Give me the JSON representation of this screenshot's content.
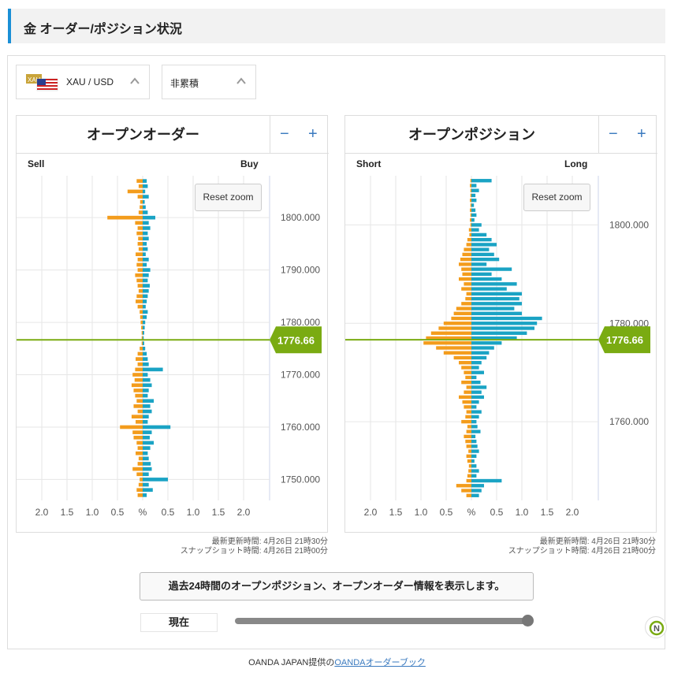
{
  "header": {
    "title": "金 オーダー/ポジション状況"
  },
  "selectors": {
    "pair_label": "XAU / USD",
    "flag_text": "XAU",
    "mode_label": "非累積"
  },
  "order_book": {
    "title": "オープンオーダー",
    "left_label": "Sell",
    "right_label": "Buy",
    "reset_label": "Reset zoom",
    "zoom_out": "−",
    "zoom_in": "+",
    "price_ticks": [
      "1800.000",
      "1790.000",
      "1780.000",
      "1770.000",
      "1760.000",
      "1750.000"
    ],
    "x_ticks": [
      "2.0",
      "1.5",
      "1.0",
      "0.5",
      "%",
      "0.5",
      "1.0",
      "1.5",
      "2.0"
    ],
    "current_price": "1776.66",
    "updated": "最新更新時間: 4月26日 21時30分",
    "snapshot": "スナップショット時間: 4月26日 21時00分"
  },
  "position_book": {
    "title": "オープンポジション",
    "left_label": "Short",
    "right_label": "Long",
    "reset_label": "Reset zoom",
    "zoom_out": "−",
    "zoom_in": "+",
    "price_ticks": [
      "1800.000",
      "1780.000",
      "1760.000"
    ],
    "x_ticks": [
      "2.0",
      "1.5",
      "1.0",
      "0.5",
      "%",
      "0.5",
      "1.0",
      "1.5",
      "2.0"
    ],
    "current_price": "1776.66",
    "updated": "最新更新時間: 4月26日 21時30分",
    "snapshot": "スナップショット時間: 4月26日 21時00分"
  },
  "history": {
    "button_label": "過去24時間のオープンポジション、オープンオーダー情報を表示します。",
    "now_label": "現在",
    "slider_value": 1.0
  },
  "footer": {
    "prefix": "OANDA JAPAN提供の",
    "link": "OANDAオーダーブック"
  },
  "colors": {
    "accent": "#1a8fd6",
    "orange": "#f39c1c",
    "teal": "#1aa3c4",
    "price_line": "#7aab12"
  },
  "chart_data": [
    {
      "type": "bar",
      "title": "オープンオーダー",
      "xlabel": "%",
      "ylim": [
        1746,
        1808
      ],
      "note_side": [
        "Sell",
        "Buy"
      ],
      "y": [
        1807,
        1806,
        1805,
        1804,
        1803,
        1802,
        1801,
        1800,
        1799,
        1798,
        1797,
        1796,
        1795,
        1794,
        1793,
        1792,
        1791,
        1790,
        1789,
        1788,
        1787,
        1786,
        1785,
        1784,
        1783,
        1782,
        1781,
        1780,
        1779,
        1778,
        1777,
        1776,
        1775,
        1774,
        1773,
        1772,
        1771,
        1770,
        1769,
        1768,
        1767,
        1766,
        1765,
        1764,
        1763,
        1762,
        1761,
        1760,
        1759,
        1758,
        1757,
        1756,
        1755,
        1754,
        1753,
        1752,
        1751,
        1750,
        1749,
        1748,
        1747
      ],
      "series": [
        {
          "name": "Sell",
          "values": [
            0.12,
            0.08,
            0.3,
            0.1,
            0.05,
            0.06,
            0.08,
            0.7,
            0.15,
            0.1,
            0.12,
            0.09,
            0.1,
            0.08,
            0.14,
            0.1,
            0.12,
            0.1,
            0.15,
            0.12,
            0.1,
            0.08,
            0.12,
            0.14,
            0.1,
            0.06,
            0.05,
            0.04,
            0.03,
            0.02,
            0.02,
            0.02,
            0.06,
            0.1,
            0.14,
            0.1,
            0.15,
            0.2,
            0.16,
            0.22,
            0.18,
            0.15,
            0.12,
            0.18,
            0.1,
            0.22,
            0.14,
            0.45,
            0.2,
            0.18,
            0.12,
            0.1,
            0.14,
            0.08,
            0.1,
            0.2,
            0.12,
            0.06,
            0.08,
            0.12,
            0.1
          ]
        },
        {
          "name": "Buy",
          "values": [
            0.08,
            0.1,
            0.05,
            0.12,
            0.04,
            0.06,
            0.1,
            0.25,
            0.12,
            0.15,
            0.1,
            0.12,
            0.08,
            0.1,
            0.06,
            0.12,
            0.08,
            0.15,
            0.12,
            0.1,
            0.14,
            0.12,
            0.1,
            0.08,
            0.06,
            0.1,
            0.08,
            0.05,
            0.04,
            0.03,
            0.02,
            0.03,
            0.05,
            0.08,
            0.1,
            0.12,
            0.4,
            0.1,
            0.15,
            0.18,
            0.12,
            0.1,
            0.22,
            0.15,
            0.18,
            0.12,
            0.1,
            0.55,
            0.18,
            0.14,
            0.22,
            0.15,
            0.1,
            0.12,
            0.16,
            0.18,
            0.12,
            0.5,
            0.12,
            0.2,
            0.08
          ]
        }
      ]
    },
    {
      "type": "bar",
      "title": "オープンポジション",
      "xlabel": "%",
      "ylim": [
        1744,
        1810
      ],
      "y": [
        1809,
        1808,
        1807,
        1806,
        1805,
        1804,
        1803,
        1802,
        1801,
        1800,
        1799,
        1798,
        1797,
        1796,
        1795,
        1794,
        1793,
        1792,
        1791,
        1790,
        1789,
        1788,
        1787,
        1786,
        1785,
        1784,
        1783,
        1782,
        1781,
        1780,
        1779,
        1778,
        1777,
        1776,
        1775,
        1774,
        1773,
        1772,
        1771,
        1770,
        1769,
        1768,
        1767,
        1766,
        1765,
        1764,
        1763,
        1762,
        1761,
        1760,
        1759,
        1758,
        1757,
        1756,
        1755,
        1754,
        1753,
        1752,
        1751,
        1750,
        1749,
        1748,
        1747,
        1746,
        1745
      ],
      "series": [
        {
          "name": "Short",
          "values": [
            0.02,
            0.03,
            0.02,
            0.02,
            0.03,
            0.02,
            0.03,
            0.02,
            0.03,
            0.02,
            0.05,
            0.04,
            0.08,
            0.1,
            0.15,
            0.18,
            0.22,
            0.25,
            0.2,
            0.18,
            0.25,
            0.15,
            0.2,
            0.1,
            0.12,
            0.2,
            0.3,
            0.35,
            0.4,
            0.55,
            0.65,
            0.8,
            0.9,
            0.95,
            0.7,
            0.55,
            0.35,
            0.25,
            0.2,
            0.15,
            0.12,
            0.2,
            0.1,
            0.15,
            0.25,
            0.18,
            0.15,
            0.1,
            0.12,
            0.2,
            0.08,
            0.1,
            0.15,
            0.12,
            0.1,
            0.06,
            0.1,
            0.08,
            0.05,
            0.06,
            0.08,
            0.1,
            0.3,
            0.2,
            0.1
          ]
        },
        {
          "name": "Long",
          "values": [
            0.4,
            0.1,
            0.15,
            0.08,
            0.1,
            0.05,
            0.08,
            0.1,
            0.06,
            0.2,
            0.15,
            0.3,
            0.4,
            0.5,
            0.35,
            0.45,
            0.55,
            0.3,
            0.8,
            0.4,
            0.6,
            0.9,
            0.7,
            1.0,
            0.95,
            1.0,
            0.85,
            1.0,
            1.4,
            1.3,
            1.25,
            1.1,
            0.9,
            0.6,
            0.45,
            0.35,
            0.3,
            0.2,
            0.15,
            0.25,
            0.1,
            0.18,
            0.3,
            0.2,
            0.25,
            0.15,
            0.1,
            0.2,
            0.15,
            0.1,
            0.12,
            0.18,
            0.08,
            0.1,
            0.12,
            0.15,
            0.1,
            0.06,
            0.1,
            0.15,
            0.1,
            0.6,
            0.25,
            0.2,
            0.15
          ]
        }
      ]
    }
  ]
}
